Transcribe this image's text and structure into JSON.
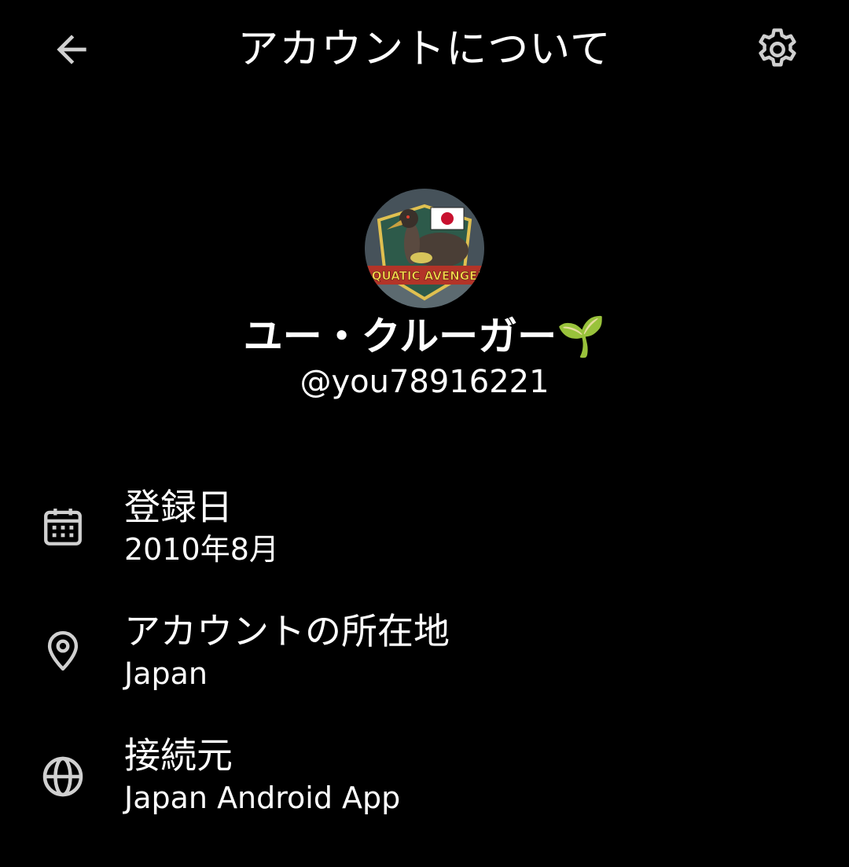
{
  "header": {
    "title": "アカウントについて",
    "back_icon": "arrow-left-icon",
    "settings_icon": "gear-icon"
  },
  "profile": {
    "display_name": "ユー・クルーガー🌱",
    "handle": "@you78916221",
    "avatar_text": "AQUATIC AVENGER"
  },
  "info": {
    "joined": {
      "icon": "calendar-icon",
      "label": "登録日",
      "value": "2010年8月"
    },
    "location": {
      "icon": "location-pin-icon",
      "label": "アカウントの所在地",
      "value": "Japan"
    },
    "connected_via": {
      "icon": "globe-icon",
      "label": "接続元",
      "value": "Japan Android App"
    }
  },
  "colors": {
    "background": "#000000",
    "text": "#ffffff",
    "icon": "#d0d0d0"
  }
}
